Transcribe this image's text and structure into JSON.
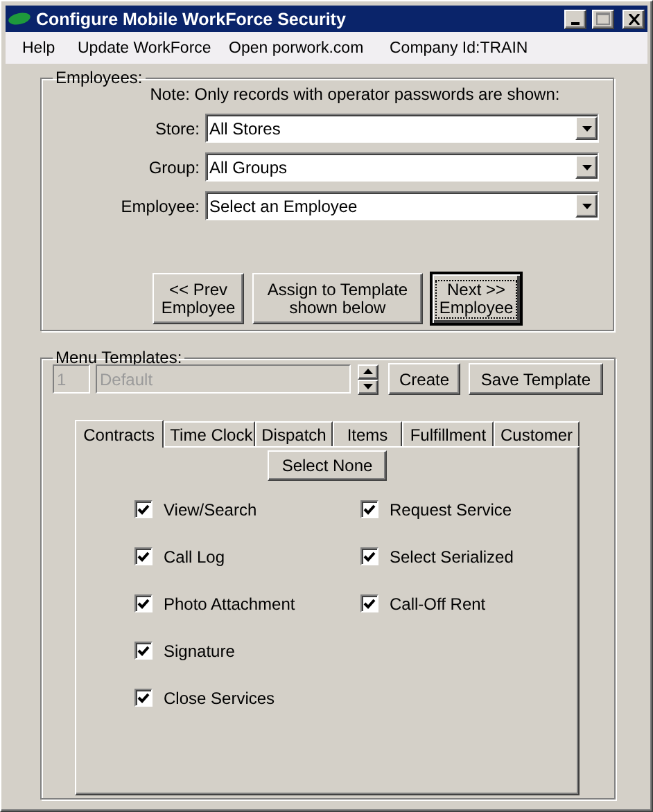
{
  "window": {
    "title": "Configure Mobile WorkForce Security"
  },
  "menu": [
    {
      "label": "Help"
    },
    {
      "label": "Update WorkForce"
    },
    {
      "label": "Open porwork.com"
    },
    {
      "label": "Company Id:TRAIN"
    }
  ],
  "employees": {
    "legend": "Employees:",
    "note": "Note: Only records with operator passwords are shown:",
    "fields": [
      {
        "label": "Store:",
        "value": "All Stores"
      },
      {
        "label": "Group:",
        "value": "All Groups"
      },
      {
        "label": "Employee:",
        "value": "Select an Employee"
      }
    ],
    "buttons": [
      {
        "lines": [
          "<< Prev",
          "Employee"
        ],
        "focused": false
      },
      {
        "lines": [
          "Assign to Template",
          "shown below"
        ],
        "focused": false
      },
      {
        "lines": [
          "Next >>",
          "Employee"
        ],
        "focused": true
      }
    ]
  },
  "templates": {
    "legend": "Menu Templates:",
    "number": "1",
    "name": "Default",
    "disabled": true,
    "buttons": [
      "Create",
      "Save Template"
    ],
    "tabs": [
      {
        "label": "Contracts",
        "selected": true
      },
      {
        "label": "Time Clock",
        "selected": false
      },
      {
        "label": "Dispatch",
        "selected": false
      },
      {
        "label": "Items",
        "selected": false
      },
      {
        "label": "Fulfillment",
        "selected": false
      },
      {
        "label": "Customer",
        "selected": false
      }
    ],
    "select_none": "Select None",
    "columns": [
      [
        {
          "label": "View/Search",
          "checked": true
        },
        {
          "label": "Call Log",
          "checked": true
        },
        {
          "label": "Photo Attachment",
          "checked": true
        },
        {
          "label": "Signature",
          "checked": true
        },
        {
          "label": "Close Services",
          "checked": true
        }
      ],
      [
        {
          "label": "Request Service",
          "checked": true
        },
        {
          "label": "Select Serialized",
          "checked": true
        },
        {
          "label": "Call-Off Rent",
          "checked": true
        }
      ]
    ]
  }
}
